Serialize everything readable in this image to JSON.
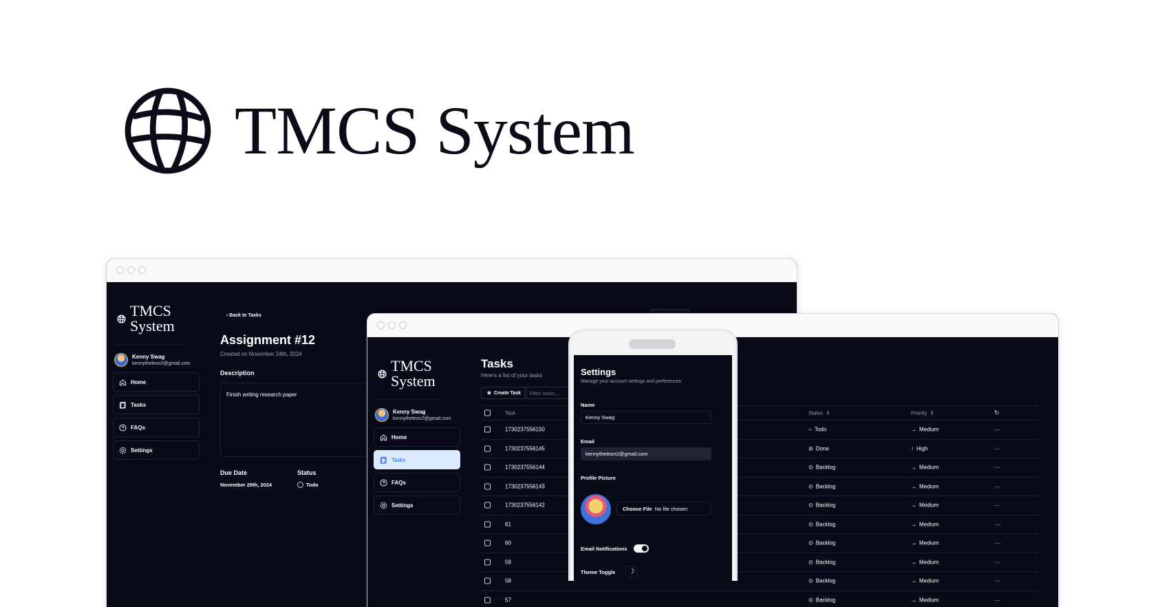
{
  "hero": {
    "title": "TMCS System"
  },
  "brand": {
    "line1": "TMCS",
    "line2": "System"
  },
  "user": {
    "name": "Kenny Swag",
    "email": "kennytheleon2@gmail.com"
  },
  "nav": [
    {
      "label": "Home",
      "icon": "home-icon"
    },
    {
      "label": "Tasks",
      "icon": "tasks-icon"
    },
    {
      "label": "FAQs",
      "icon": "help-circle-icon"
    },
    {
      "label": "Settings",
      "icon": "gear-icon"
    }
  ],
  "assignment": {
    "back_label": "Back to Tasks",
    "title": "Assignment #12",
    "created": "Created on November 24th, 2024",
    "description_label": "Description",
    "description": "Finish writing research paper",
    "due_label": "Due Date",
    "due_value": "November 29th, 2024",
    "status_label": "Status",
    "status_value": "Todo"
  },
  "tasks": {
    "title": "Tasks",
    "subtitle": "Here's a list of your tasks",
    "create_label": "Create Task",
    "filter_placeholder": "Filter tasks...",
    "headers": {
      "task": "Task",
      "status": "Status",
      "priority": "Priority"
    },
    "rows": [
      {
        "task": "1730237556150",
        "status": "Todo",
        "priority": "Medium"
      },
      {
        "task": "1730237556145",
        "status": "Done",
        "priority": "High"
      },
      {
        "task": "1730237556144",
        "status": "Backlog",
        "priority": "Medium"
      },
      {
        "task": "1730237556143",
        "status": "Backlog",
        "priority": "Medium"
      },
      {
        "task": "1730237556142",
        "status": "Backlog",
        "priority": "Medium"
      },
      {
        "task": "61",
        "status": "Backlog",
        "priority": "Medium"
      },
      {
        "task": "60",
        "status": "Backlog",
        "priority": "Medium"
      },
      {
        "task": "59",
        "status": "Backlog",
        "priority": "Medium"
      },
      {
        "task": "58",
        "status": "Backlog",
        "priority": "Medium"
      },
      {
        "task": "57",
        "status": "Backlog",
        "priority": "Medium"
      }
    ]
  },
  "settings": {
    "title": "Settings",
    "subtitle": "Manage your account settings and preferences",
    "name_label": "Name",
    "name_value": "Kenny Swag",
    "email_label": "Email",
    "email_value": "kennytheleon2@gmail.com",
    "picture_label": "Profile Picture",
    "file_button": "Choose File",
    "file_status": "No file chosen",
    "notifications_label": "Email Notifications",
    "notifications_on": true,
    "theme_label": "Theme Toggle"
  },
  "colors": {
    "background": "#080b17",
    "accent": "#dbeafe",
    "accent_text": "#2563eb",
    "border": "#1f2434"
  }
}
